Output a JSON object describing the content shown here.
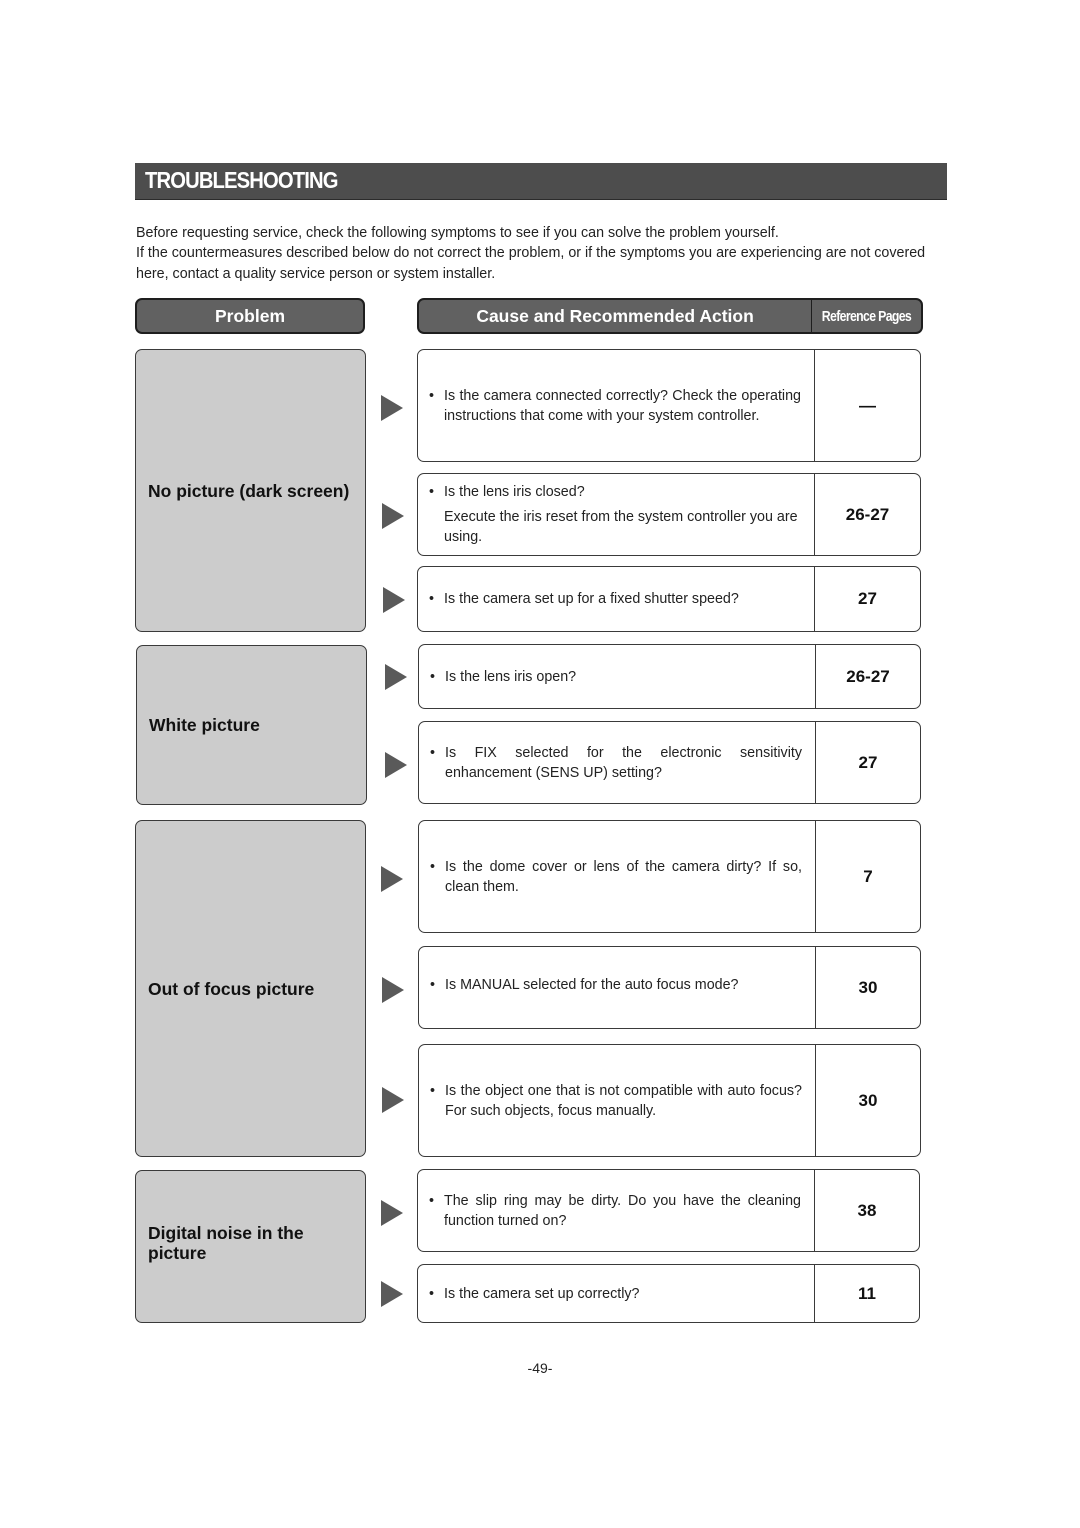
{
  "page": {
    "title": "TROUBLESHOOTING",
    "intro": [
      "Before requesting service, check the following symptoms to see if you can solve the problem yourself.",
      "If the countermeasures described below do not correct the problem, or if the symptoms you are experiencing are not covered here, contact a quality service person or system installer."
    ],
    "page_number": "-49-"
  },
  "table_header": {
    "problem": "Problem",
    "cause": "Cause and Recommended Action",
    "reference": "Reference Pages"
  },
  "problems": [
    {
      "label": "No picture (dark screen)",
      "causes": [
        {
          "bullet": "•",
          "text": "Is the camera connected correctly? Check the operating instructions that come with your system controller.",
          "sub": "",
          "ref": "—"
        },
        {
          "bullet": "•",
          "text": "Is the lens iris closed?",
          "sub": "Execute the iris reset from the system controller you are using.",
          "ref": "26-27"
        },
        {
          "bullet": "•",
          "text": "Is the camera set up for a fixed shutter speed?",
          "sub": "",
          "ref": "27"
        }
      ]
    },
    {
      "label": "White picture",
      "causes": [
        {
          "bullet": "•",
          "text": "Is the lens iris open?",
          "sub": "",
          "ref": "26-27"
        },
        {
          "bullet": "•",
          "text": "Is FIX selected for the electronic sensitivity enhancement (SENS UP) setting?",
          "sub": "",
          "ref": "27"
        }
      ]
    },
    {
      "label": "Out of focus picture",
      "causes": [
        {
          "bullet": "•",
          "text": "Is the dome cover or lens of the camera dirty? If so, clean them.",
          "sub": "",
          "ref": "7"
        },
        {
          "bullet": "•",
          "text": "Is MANUAL selected for the auto focus mode?",
          "sub": "",
          "ref": "30"
        },
        {
          "bullet": "•",
          "text": "Is the object one that is not compatible with auto focus? For such objects, focus manually.",
          "sub": "",
          "ref": "30"
        }
      ]
    },
    {
      "label": "Digital noise in the picture",
      "causes": [
        {
          "bullet": "•",
          "text": "The slip ring may be dirty. Do you have the cleaning function turned on?",
          "sub": "",
          "ref": "38"
        },
        {
          "bullet": "•",
          "text": "Is the camera set up correctly?",
          "sub": "",
          "ref": "11"
        }
      ]
    }
  ]
}
